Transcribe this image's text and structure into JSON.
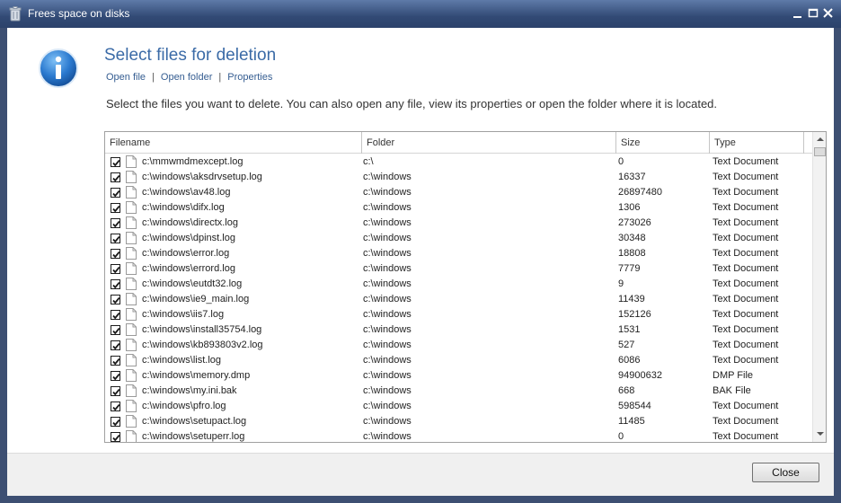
{
  "window": {
    "title": "Frees space on disks"
  },
  "page": {
    "heading": "Select files for deletion",
    "links": [
      "Open file",
      "Open folder",
      "Properties"
    ],
    "separator": "|",
    "instruction": "Select the files you want to delete. You can also open any file, view its properties or open the folder where it is located."
  },
  "table": {
    "columns": [
      "Filename",
      "Folder",
      "Size",
      "Type"
    ],
    "rows": [
      {
        "checked": true,
        "filename": "c:\\mmwmdmexcept.log",
        "folder": "c:\\",
        "size": "0",
        "type": "Text Document"
      },
      {
        "checked": true,
        "filename": "c:\\windows\\aksdrvsetup.log",
        "folder": "c:\\windows",
        "size": "16337",
        "type": "Text Document"
      },
      {
        "checked": true,
        "filename": "c:\\windows\\av48.log",
        "folder": "c:\\windows",
        "size": "26897480",
        "type": "Text Document"
      },
      {
        "checked": true,
        "filename": "c:\\windows\\difx.log",
        "folder": "c:\\windows",
        "size": "1306",
        "type": "Text Document"
      },
      {
        "checked": true,
        "filename": "c:\\windows\\directx.log",
        "folder": "c:\\windows",
        "size": "273026",
        "type": "Text Document"
      },
      {
        "checked": true,
        "filename": "c:\\windows\\dpinst.log",
        "folder": "c:\\windows",
        "size": "30348",
        "type": "Text Document"
      },
      {
        "checked": true,
        "filename": "c:\\windows\\error.log",
        "folder": "c:\\windows",
        "size": "18808",
        "type": "Text Document"
      },
      {
        "checked": true,
        "filename": "c:\\windows\\errord.log",
        "folder": "c:\\windows",
        "size": "7779",
        "type": "Text Document"
      },
      {
        "checked": true,
        "filename": "c:\\windows\\eutdt32.log",
        "folder": "c:\\windows",
        "size": "9",
        "type": "Text Document"
      },
      {
        "checked": true,
        "filename": "c:\\windows\\ie9_main.log",
        "folder": "c:\\windows",
        "size": "11439",
        "type": "Text Document"
      },
      {
        "checked": true,
        "filename": "c:\\windows\\iis7.log",
        "folder": "c:\\windows",
        "size": "152126",
        "type": "Text Document"
      },
      {
        "checked": true,
        "filename": "c:\\windows\\install35754.log",
        "folder": "c:\\windows",
        "size": "1531",
        "type": "Text Document"
      },
      {
        "checked": true,
        "filename": "c:\\windows\\kb893803v2.log",
        "folder": "c:\\windows",
        "size": "527",
        "type": "Text Document"
      },
      {
        "checked": true,
        "filename": "c:\\windows\\list.log",
        "folder": "c:\\windows",
        "size": "6086",
        "type": "Text Document"
      },
      {
        "checked": true,
        "filename": "c:\\windows\\memory.dmp",
        "folder": "c:\\windows",
        "size": "94900632",
        "type": "DMP File"
      },
      {
        "checked": true,
        "filename": "c:\\windows\\my.ini.bak",
        "folder": "c:\\windows",
        "size": "668",
        "type": "BAK File"
      },
      {
        "checked": true,
        "filename": "c:\\windows\\pfro.log",
        "folder": "c:\\windows",
        "size": "598544",
        "type": "Text Document"
      },
      {
        "checked": true,
        "filename": "c:\\windows\\setupact.log",
        "folder": "c:\\windows",
        "size": "11485",
        "type": "Text Document"
      },
      {
        "checked": true,
        "filename": "c:\\windows\\setuperr.log",
        "folder": "c:\\windows",
        "size": "0",
        "type": "Text Document"
      }
    ]
  },
  "footer": {
    "close_label": "Close"
  },
  "colors": {
    "titlebar": "#324a75",
    "heading": "#3b6ba7",
    "link": "#355d91"
  }
}
